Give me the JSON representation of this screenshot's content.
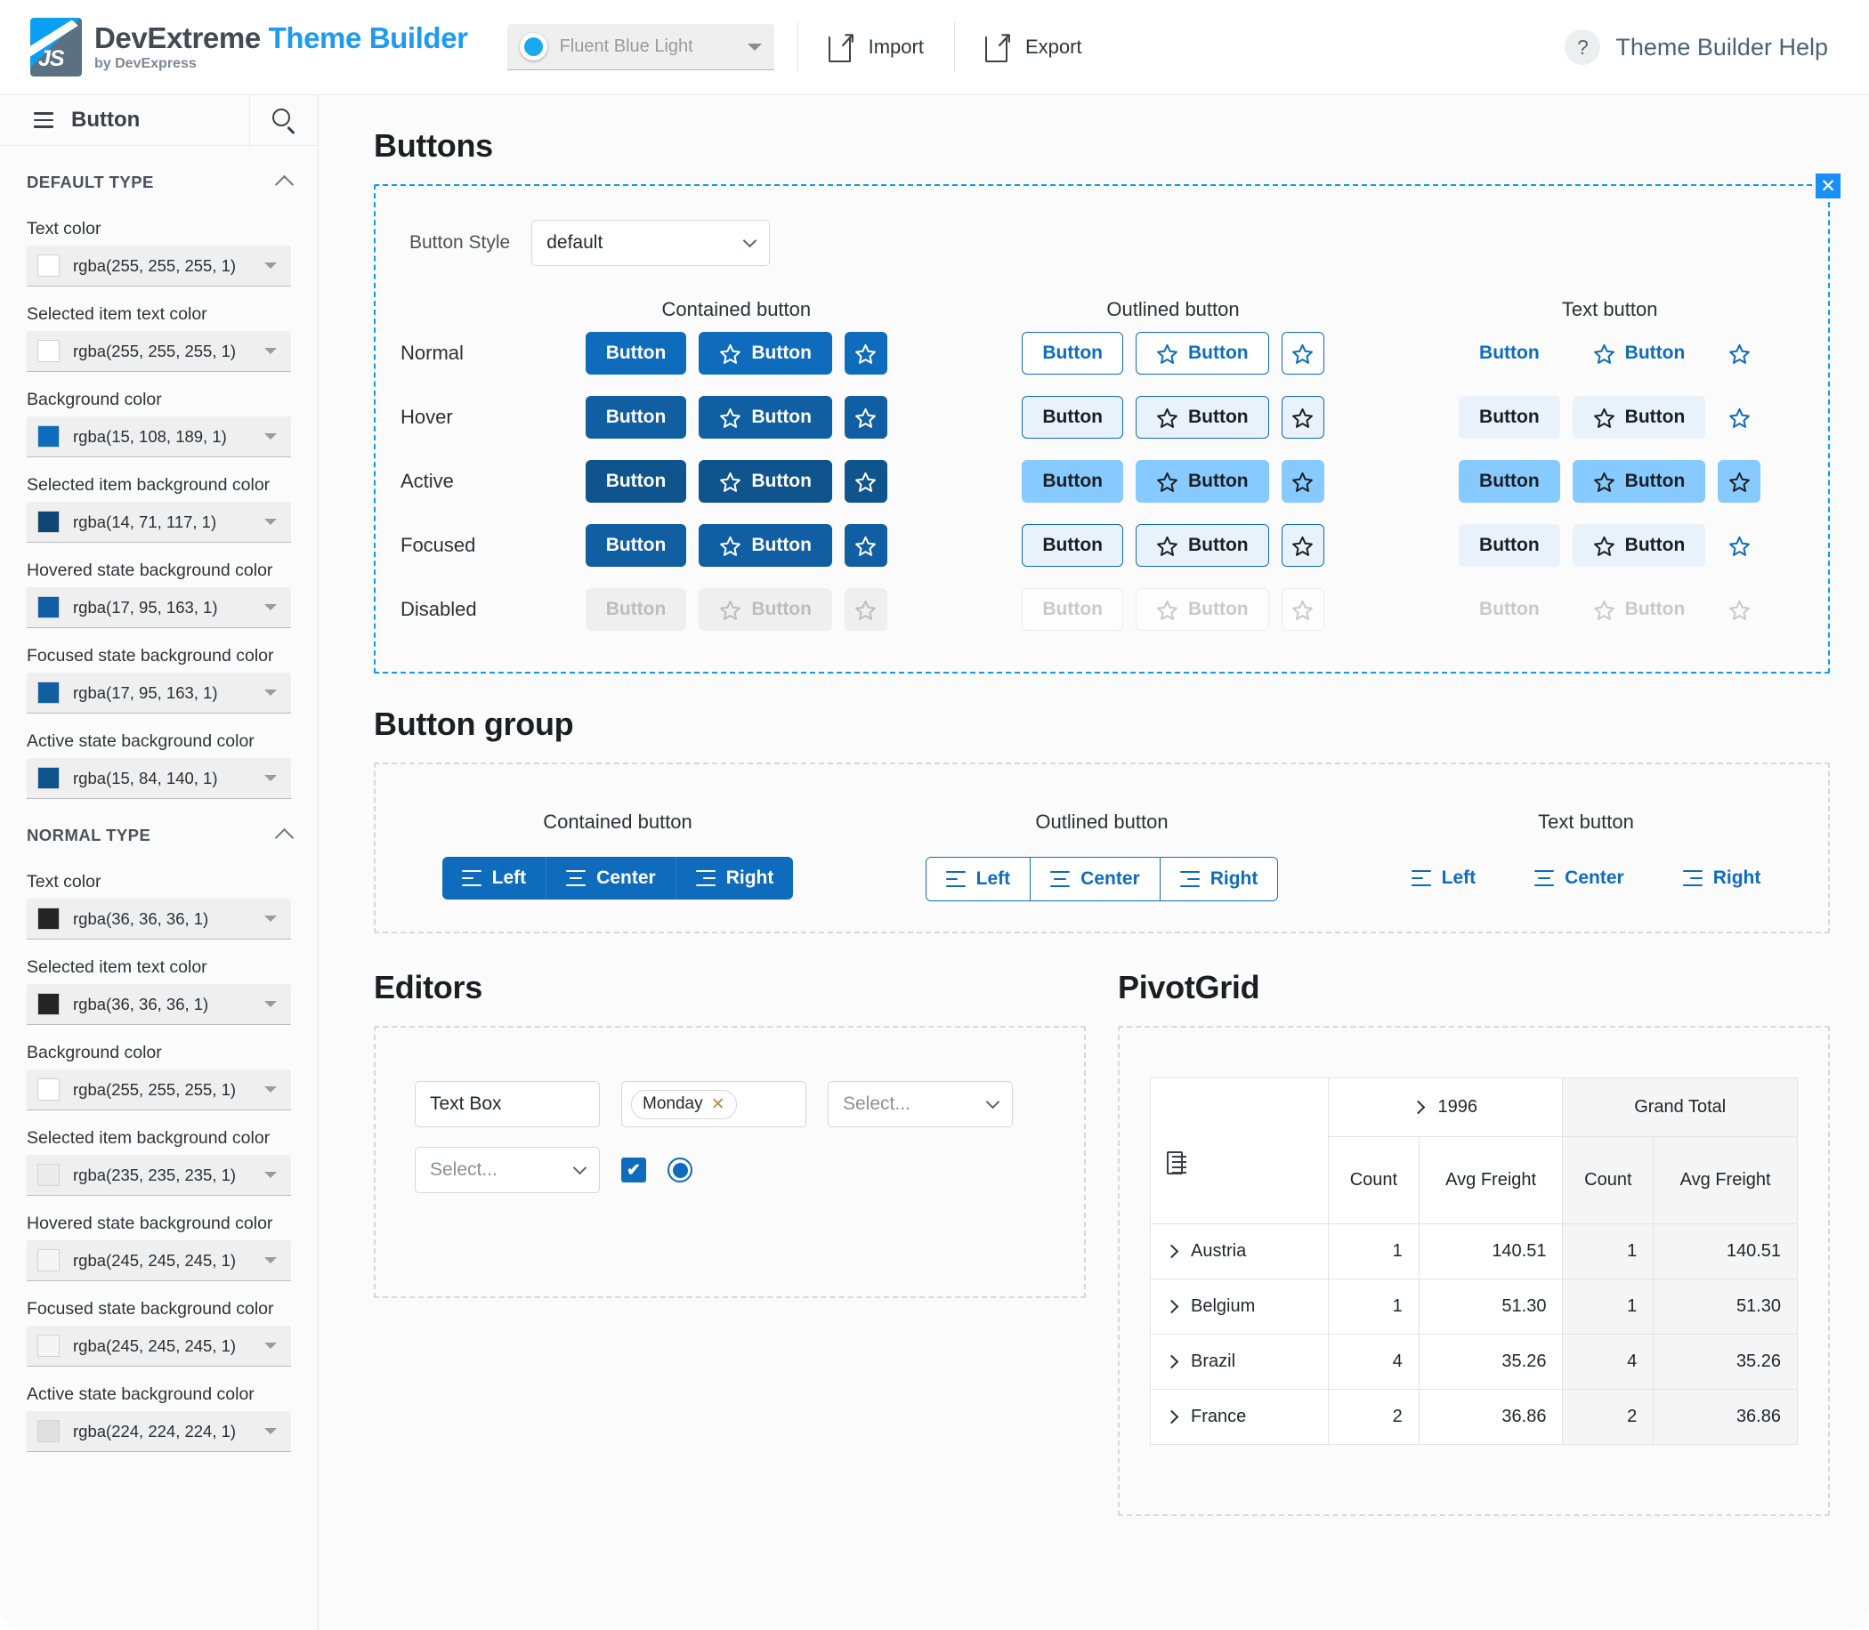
{
  "header": {
    "brand_primary": "DevExtreme",
    "brand_secondary": "Theme Builder",
    "brand_sub": "by DevExpress",
    "logo_text": "JS",
    "theme_selected": "Fluent Blue Light",
    "theme_swatch_color": "#1aa9f0",
    "import_label": "Import",
    "export_label": "Export",
    "help_mark": "?",
    "help_label": "Theme Builder Help"
  },
  "sidebar": {
    "title": "Button",
    "sections": [
      {
        "title": "DEFAULT TYPE",
        "fields": [
          {
            "label": "Text color",
            "value": "rgba(255, 255, 255, 1)",
            "swatch": "#ffffff"
          },
          {
            "label": "Selected item text color",
            "value": "rgba(255, 255, 255, 1)",
            "swatch": "#ffffff"
          },
          {
            "label": "Background color",
            "value": "rgba(15, 108, 189, 1)",
            "swatch": "#0f6cbd"
          },
          {
            "label": "Selected item background color",
            "value": "rgba(14, 71, 117, 1)",
            "swatch": "#0e4775"
          },
          {
            "label": "Hovered state background color",
            "value": "rgba(17, 95, 163, 1)",
            "swatch": "#115fa3"
          },
          {
            "label": "Focused state background color",
            "value": "rgba(17, 95, 163, 1)",
            "swatch": "#115fa3"
          },
          {
            "label": "Active state background color",
            "value": "rgba(15, 84, 140, 1)",
            "swatch": "#0f548c"
          }
        ]
      },
      {
        "title": "NORMAL TYPE",
        "fields": [
          {
            "label": "Text color",
            "value": "rgba(36, 36, 36, 1)",
            "swatch": "#242424"
          },
          {
            "label": "Selected item text color",
            "value": "rgba(36, 36, 36, 1)",
            "swatch": "#242424"
          },
          {
            "label": "Background color",
            "value": "rgba(255, 255, 255, 1)",
            "swatch": "#ffffff"
          },
          {
            "label": "Selected item background color",
            "value": "rgba(235, 235, 235, 1)",
            "swatch": "#ebebeb"
          },
          {
            "label": "Hovered state background color",
            "value": "rgba(245, 245, 245, 1)",
            "swatch": "#f5f5f5"
          },
          {
            "label": "Focused state background color",
            "value": "rgba(245, 245, 245, 1)",
            "swatch": "#f5f5f5"
          },
          {
            "label": "Active state background color",
            "value": "rgba(224, 224, 224, 1)",
            "swatch": "#e0e0e0"
          }
        ]
      }
    ]
  },
  "main": {
    "buttons_section": {
      "heading": "Buttons",
      "style_label": "Button Style",
      "style_value": "default",
      "close_label": "✕",
      "columns": [
        "Contained button",
        "Outlined button",
        "Text button"
      ],
      "rows": [
        "Normal",
        "Hover",
        "Active",
        "Focused",
        "Disabled"
      ],
      "button_label": "Button"
    },
    "button_group_section": {
      "heading": "Button group",
      "columns": [
        "Contained button",
        "Outlined button",
        "Text button"
      ],
      "items": [
        "Left",
        "Center",
        "Right"
      ]
    },
    "editors_section": {
      "heading": "Editors",
      "textbox_value": "Text Box",
      "tag_value": "Monday",
      "tag_remove": "✕",
      "select_placeholder_1": "Select...",
      "select_placeholder_2": "Select...",
      "checkbox_checked": true,
      "checkbox_mark": "✔",
      "radio_selected": true
    },
    "pivot_section": {
      "heading": "PivotGrid",
      "column_group": "1996",
      "grand_total": "Grand Total",
      "measures": [
        "Count",
        "Avg Freight"
      ],
      "rows": [
        {
          "country": "Austria",
          "count_1996": "1",
          "avg_1996": "140.51",
          "count_total": "1",
          "avg_total": "140.51"
        },
        {
          "country": "Belgium",
          "count_1996": "1",
          "avg_1996": "51.30",
          "count_total": "1",
          "avg_total": "51.30"
        },
        {
          "country": "Brazil",
          "count_1996": "4",
          "avg_1996": "35.26",
          "count_total": "4",
          "avg_total": "35.26"
        },
        {
          "country": "France",
          "count_1996": "2",
          "avg_1996": "36.86",
          "count_total": "2",
          "avg_total": "36.86"
        }
      ]
    }
  },
  "colors": {
    "accent": "#0f6cbd",
    "hover": "#115fa3",
    "active": "#0f548c",
    "panel_outline": "#0d9bf5"
  }
}
